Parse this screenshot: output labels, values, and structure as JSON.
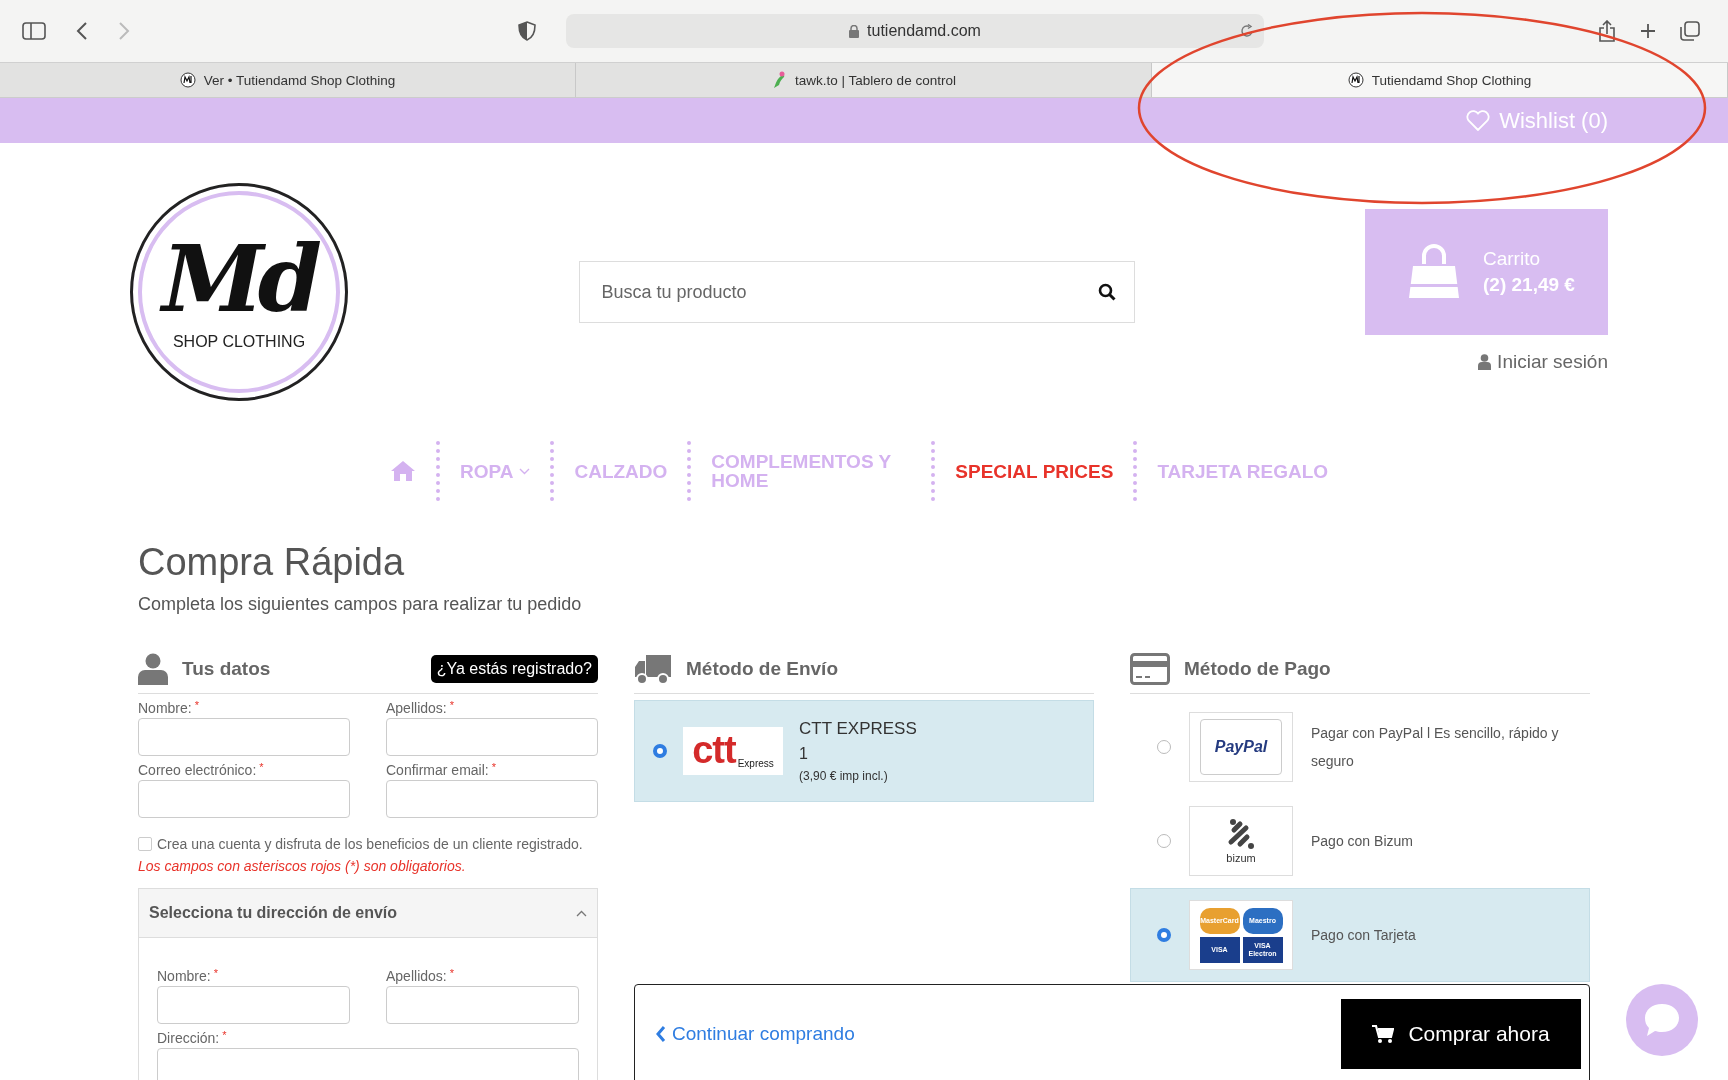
{
  "browser": {
    "url": "tutiendamd.com",
    "tabs": [
      {
        "title": "Ver • Tutiendamd Shop Clothing",
        "selected": false
      },
      {
        "title": "tawk.to | Tablero de control",
        "selected": false
      },
      {
        "title": "Tutiendamd Shop Clothing",
        "selected": true
      }
    ]
  },
  "topbar": {
    "wishlist": "Wishlist (0)"
  },
  "header": {
    "logo": {
      "monogram": "Md",
      "tagline": "SHOP CLOTHING"
    },
    "search": {
      "placeholder": "Busca tu producto"
    },
    "cart": {
      "label": "Carrito",
      "summary": "(2) 21,49 €"
    },
    "login": "Iniciar sesión"
  },
  "nav": [
    {
      "kind": "home"
    },
    {
      "kind": "link",
      "label": "ROPA",
      "dropdown": true,
      "highlight": false
    },
    {
      "kind": "link",
      "label": "CALZADO",
      "dropdown": false,
      "highlight": false
    },
    {
      "kind": "link",
      "label": "COMPLEMENTOS Y HOME",
      "dropdown": false,
      "highlight": false
    },
    {
      "kind": "link",
      "label": "SPECIAL PRICES",
      "dropdown": false,
      "highlight": true
    },
    {
      "kind": "link",
      "label": "TARJETA REGALO",
      "dropdown": false,
      "highlight": false
    }
  ],
  "page": {
    "title": "Compra Rápida",
    "subtitle": "Completa los siguientes campos para realizar tu pedido"
  },
  "customer": {
    "heading": "Tus datos",
    "login_button": "¿Ya estás registrado?",
    "fields": [
      {
        "label": "Nombre:",
        "required_mark": "*",
        "wide": false
      },
      {
        "label": "Apellidos:",
        "required_mark": "*",
        "wide": false
      },
      {
        "label": "Correo electrónico:",
        "required_mark": "*",
        "wide": false
      },
      {
        "label": "Confirmar email:",
        "required_mark": "*",
        "wide": false
      }
    ],
    "checkbox": {
      "label": "Crea una cuenta y disfruta de los beneficios de un cliente registrado.",
      "checked": false
    },
    "note": "Los campos con asteriscos rojos (*) son obligatorios."
  },
  "address": {
    "heading": "Selecciona tu dirección de envío",
    "expanded": true,
    "fields": [
      {
        "label": "Nombre:",
        "required_mark": "*",
        "wide": false
      },
      {
        "label": "Apellidos:",
        "required_mark": "*",
        "wide": false
      },
      {
        "label": "Dirección:",
        "required_mark": "*",
        "wide": true
      }
    ]
  },
  "shipping": {
    "heading": "Método de Envío",
    "options": [
      {
        "logo_main": "ctt",
        "logo_sub": "Express",
        "name": "CTT EXPRESS",
        "line": "1",
        "price": "(3,90 € imp incl.)",
        "selected": true
      }
    ]
  },
  "payment": {
    "heading": "Método de Pago",
    "options": [
      {
        "kind": "paypal",
        "logo_texts": [
          "PayPal"
        ],
        "text": "Pagar con PayPal l Es sencillo, rápido y seguro",
        "selected": false
      },
      {
        "kind": "bizum",
        "logo_texts": [
          "bizum"
        ],
        "text": "Pago con Bizum",
        "selected": false
      },
      {
        "kind": "cards",
        "logo_texts": [
          "MasterCard",
          "Maestro",
          "VISA",
          "VISA Electron"
        ],
        "text": "Pago con Tarjeta",
        "selected": true
      }
    ]
  },
  "footer_bar": {
    "continue": "Continuar comprando",
    "buy": "Comprar ahora"
  }
}
